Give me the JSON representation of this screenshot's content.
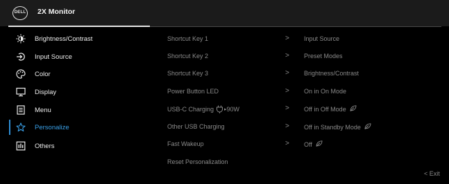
{
  "header": {
    "logo_text": "DELL",
    "title": "2X Monitor"
  },
  "sidebar": {
    "items": [
      {
        "label": "Brightness/Contrast",
        "icon": "brightness-icon"
      },
      {
        "label": "Input Source",
        "icon": "input-source-icon"
      },
      {
        "label": "Color",
        "icon": "color-palette-icon"
      },
      {
        "label": "Display",
        "icon": "display-icon"
      },
      {
        "label": "Menu",
        "icon": "menu-icon"
      },
      {
        "label": "Personalize",
        "icon": "star-icon",
        "active": true
      },
      {
        "label": "Others",
        "icon": "others-icon"
      }
    ],
    "active_color": "#3aa0e8"
  },
  "main": {
    "rows": [
      {
        "label": "Shortcut Key 1",
        "value": "Input Source"
      },
      {
        "label": "Shortcut Key 2",
        "value": "Preset Modes"
      },
      {
        "label": "Shortcut Key 3",
        "value": "Brightness/Contrast"
      },
      {
        "label": "Power Button LED",
        "value": "On in On Mode"
      },
      {
        "label": "USB-C Charging",
        "label_suffix": "90W",
        "value": "Off in Off Mode",
        "leaf": true
      },
      {
        "label": "Other USB Charging",
        "value": "Off in Standby Mode",
        "leaf": true
      },
      {
        "label": "Fast Wakeup",
        "value": "Off",
        "leaf": true
      },
      {
        "label": "Reset Personalization"
      }
    ],
    "chevron": ">"
  },
  "footer": {
    "exit_label": "< Exit"
  }
}
